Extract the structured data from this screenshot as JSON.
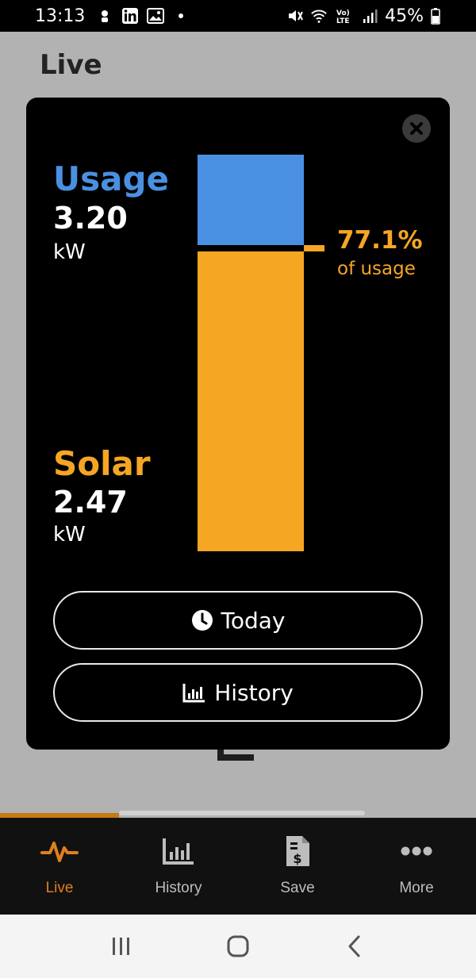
{
  "status_bar": {
    "time": "13:13",
    "battery": "45%",
    "left_icons": [
      "notification-app-icon",
      "linkedin-icon",
      "gallery-icon",
      "dot-icon"
    ],
    "right_icons": [
      "mute-icon",
      "wifi-icon",
      "volte-lte-icon",
      "signal-icon",
      "battery-icon"
    ]
  },
  "page": {
    "title": "Live"
  },
  "modal": {
    "usage": {
      "label": "Usage",
      "value": "3.20",
      "unit": "kW"
    },
    "solar": {
      "label": "Solar",
      "value": "2.47",
      "unit": "kW"
    },
    "solar_share": {
      "value": "77.1%",
      "caption": "of usage"
    },
    "buttons": {
      "today": "Today",
      "history": "History"
    }
  },
  "bottom_nav": {
    "items": [
      {
        "label": "Live",
        "icon": "pulse-icon",
        "active": true
      },
      {
        "label": "History",
        "icon": "bar-chart-icon",
        "active": false
      },
      {
        "label": "Save",
        "icon": "bill-icon",
        "active": false
      },
      {
        "label": "More",
        "icon": "more-dots-icon",
        "active": false
      }
    ]
  },
  "colors": {
    "usage": "#4a90e2",
    "solar": "#f5a623",
    "active_nav": "#e07f1f"
  }
}
